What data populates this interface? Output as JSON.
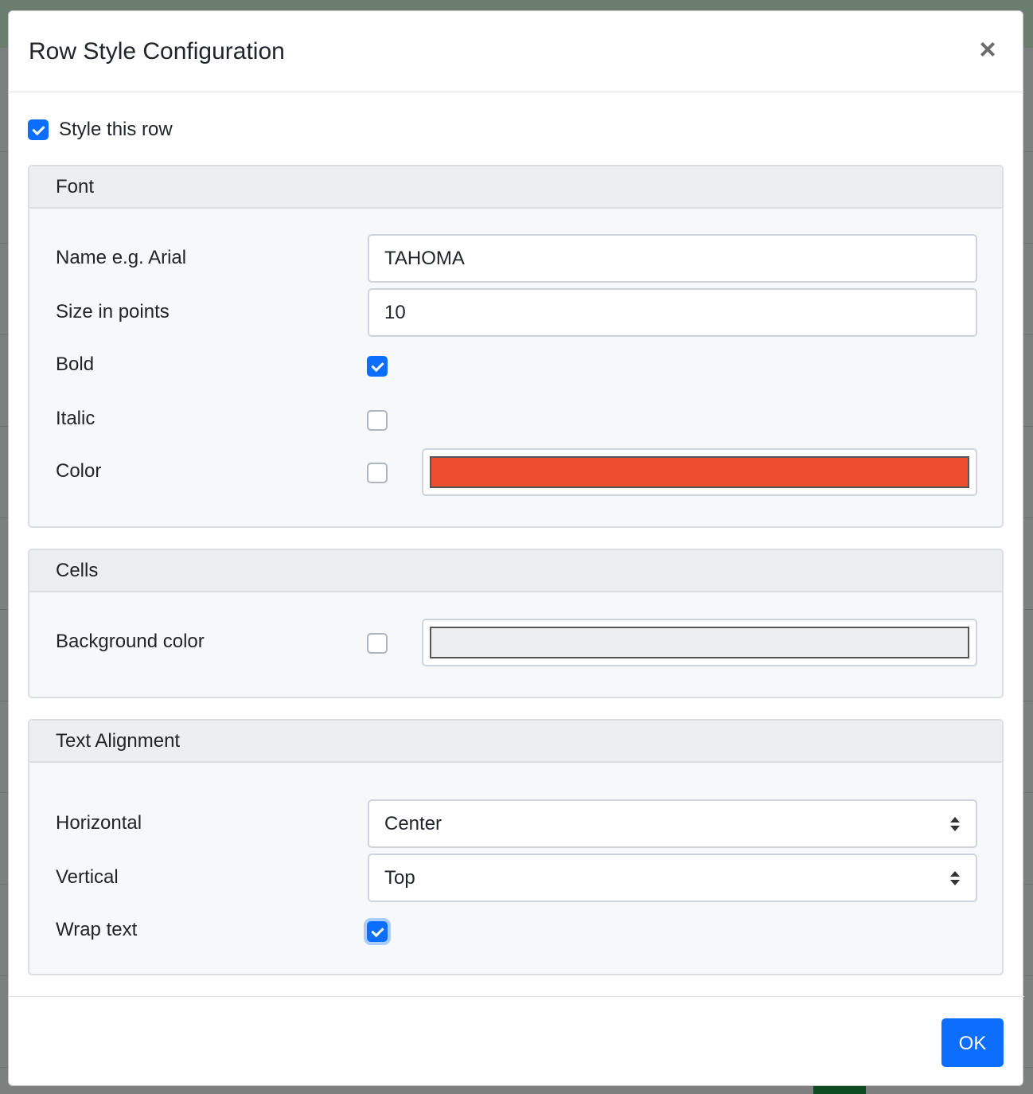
{
  "dialog": {
    "title": "Row Style Configuration",
    "close_glyph": "×"
  },
  "style_row": {
    "label": "Style this row",
    "checked": true
  },
  "font": {
    "header": "Font",
    "name_label": "Name e.g. Arial",
    "name_value": "TAHOMA",
    "size_label": "Size in points",
    "size_value": "10",
    "bold_label": "Bold",
    "bold_checked": true,
    "italic_label": "Italic",
    "italic_checked": false,
    "color_label": "Color",
    "color_checked": false,
    "color_value": "#ee4e30"
  },
  "cells": {
    "header": "Cells",
    "bg_label": "Background color",
    "bg_checked": false,
    "bg_value": "#eceef0"
  },
  "alignment": {
    "header": "Text Alignment",
    "horizontal_label": "Horizontal",
    "horizontal_value": "Center",
    "vertical_label": "Vertical",
    "vertical_value": "Top",
    "wrap_label": "Wrap text",
    "wrap_checked": true
  },
  "footer": {
    "ok_label": "OK"
  },
  "colors": {
    "accent": "#0d6efd"
  }
}
